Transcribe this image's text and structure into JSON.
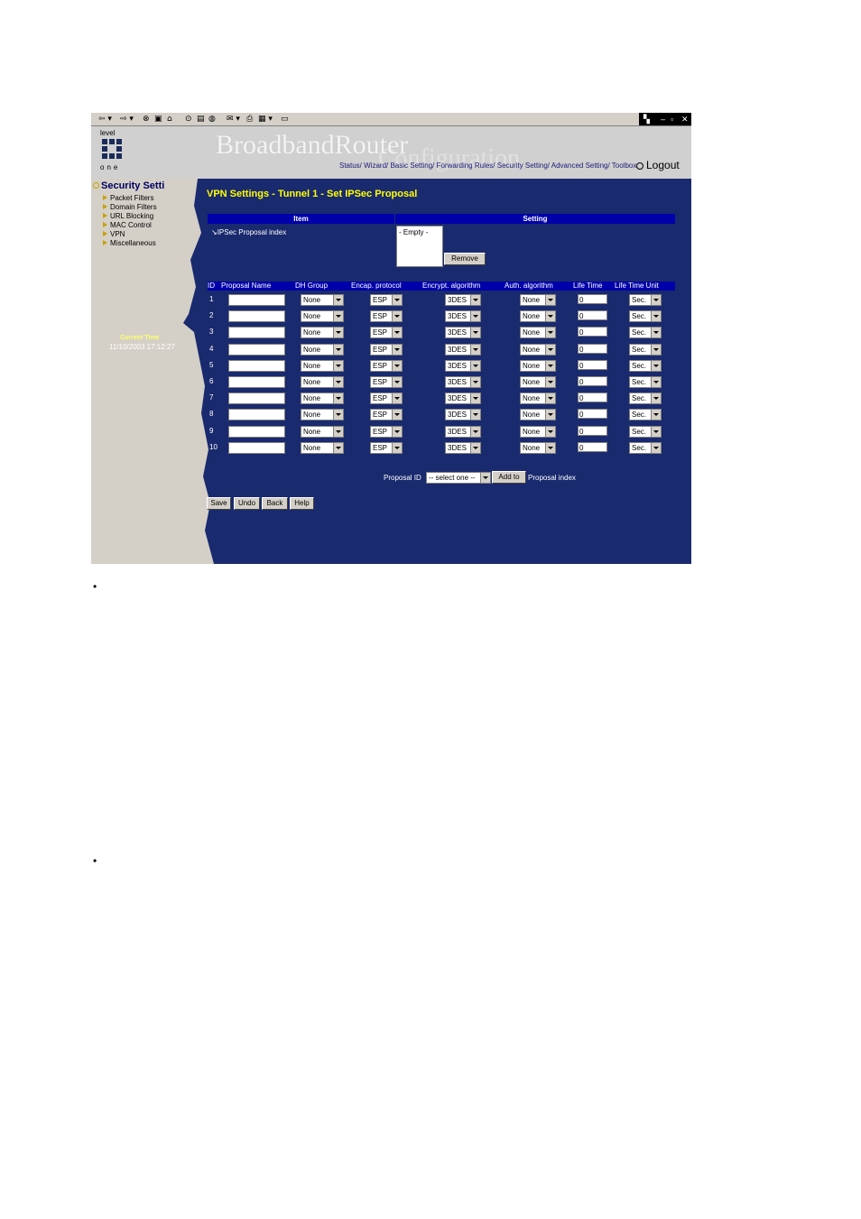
{
  "header": {
    "brand": "BroadbandRouter",
    "subbrand": "Configuration",
    "logout": "Logout",
    "nav": "Status/ Wizard/ Basic Setting/ Forwarding Rules/ Security Setting/ Advanced Setting/ Toolbox",
    "logo_top": "level",
    "logo_bottom": "one"
  },
  "sidebar": {
    "title": "Security Setti",
    "items": [
      "Packet Filters",
      "Domain Filters",
      "URL Blocking",
      "MAC Control",
      "VPN",
      "Miscellaneous"
    ],
    "current_time_label": "Current Time",
    "current_time": "11/10/2003 17:12:27"
  },
  "page_title": "VPN Settings - Tunnel 1 - Set IPSec Proposal",
  "table_headers": {
    "item": "Item",
    "setting": "Setting"
  },
  "proposal_index_label": "IPSec Proposal index",
  "proposal_index_list": "- Empty -",
  "remove_button": "Remove",
  "columns": [
    "ID",
    "Proposal Name",
    "DH Group",
    "Encap. protocol",
    "Encrypt. algorithm",
    "Auth. algorithm",
    "Life Time",
    "Life Time Unit"
  ],
  "rows": [
    {
      "id": "1",
      "name": "",
      "dh": "None",
      "encap": "ESP",
      "encrypt": "3DES",
      "auth": "None",
      "life": "0",
      "unit": "Sec."
    },
    {
      "id": "2",
      "name": "",
      "dh": "None",
      "encap": "ESP",
      "encrypt": "3DES",
      "auth": "None",
      "life": "0",
      "unit": "Sec."
    },
    {
      "id": "3",
      "name": "",
      "dh": "None",
      "encap": "ESP",
      "encrypt": "3DES",
      "auth": "None",
      "life": "0",
      "unit": "Sec."
    },
    {
      "id": "4",
      "name": "",
      "dh": "None",
      "encap": "ESP",
      "encrypt": "3DES",
      "auth": "None",
      "life": "0",
      "unit": "Sec."
    },
    {
      "id": "5",
      "name": "",
      "dh": "None",
      "encap": "ESP",
      "encrypt": "3DES",
      "auth": "None",
      "life": "0",
      "unit": "Sec."
    },
    {
      "id": "6",
      "name": "",
      "dh": "None",
      "encap": "ESP",
      "encrypt": "3DES",
      "auth": "None",
      "life": "0",
      "unit": "Sec."
    },
    {
      "id": "7",
      "name": "",
      "dh": "None",
      "encap": "ESP",
      "encrypt": "3DES",
      "auth": "None",
      "life": "0",
      "unit": "Sec."
    },
    {
      "id": "8",
      "name": "",
      "dh": "None",
      "encap": "ESP",
      "encrypt": "3DES",
      "auth": "None",
      "life": "0",
      "unit": "Sec."
    },
    {
      "id": "9",
      "name": "",
      "dh": "None",
      "encap": "ESP",
      "encrypt": "3DES",
      "auth": "None",
      "life": "0",
      "unit": "Sec."
    },
    {
      "id": "10",
      "name": "",
      "dh": "None",
      "encap": "ESP",
      "encrypt": "3DES",
      "auth": "None",
      "life": "0",
      "unit": "Sec."
    }
  ],
  "proposal_id": {
    "label": "Proposal ID",
    "select": "-- select one --",
    "add_button": "Add to",
    "suffix": "Proposal index"
  },
  "buttons": {
    "save": "Save",
    "undo": "Undo",
    "back": "Back",
    "help": "Help"
  },
  "bullet_glyph": "•",
  "colors": {
    "panel": "#1a2a6e",
    "header_bar": "#0000aa",
    "title": "#ffff00"
  }
}
